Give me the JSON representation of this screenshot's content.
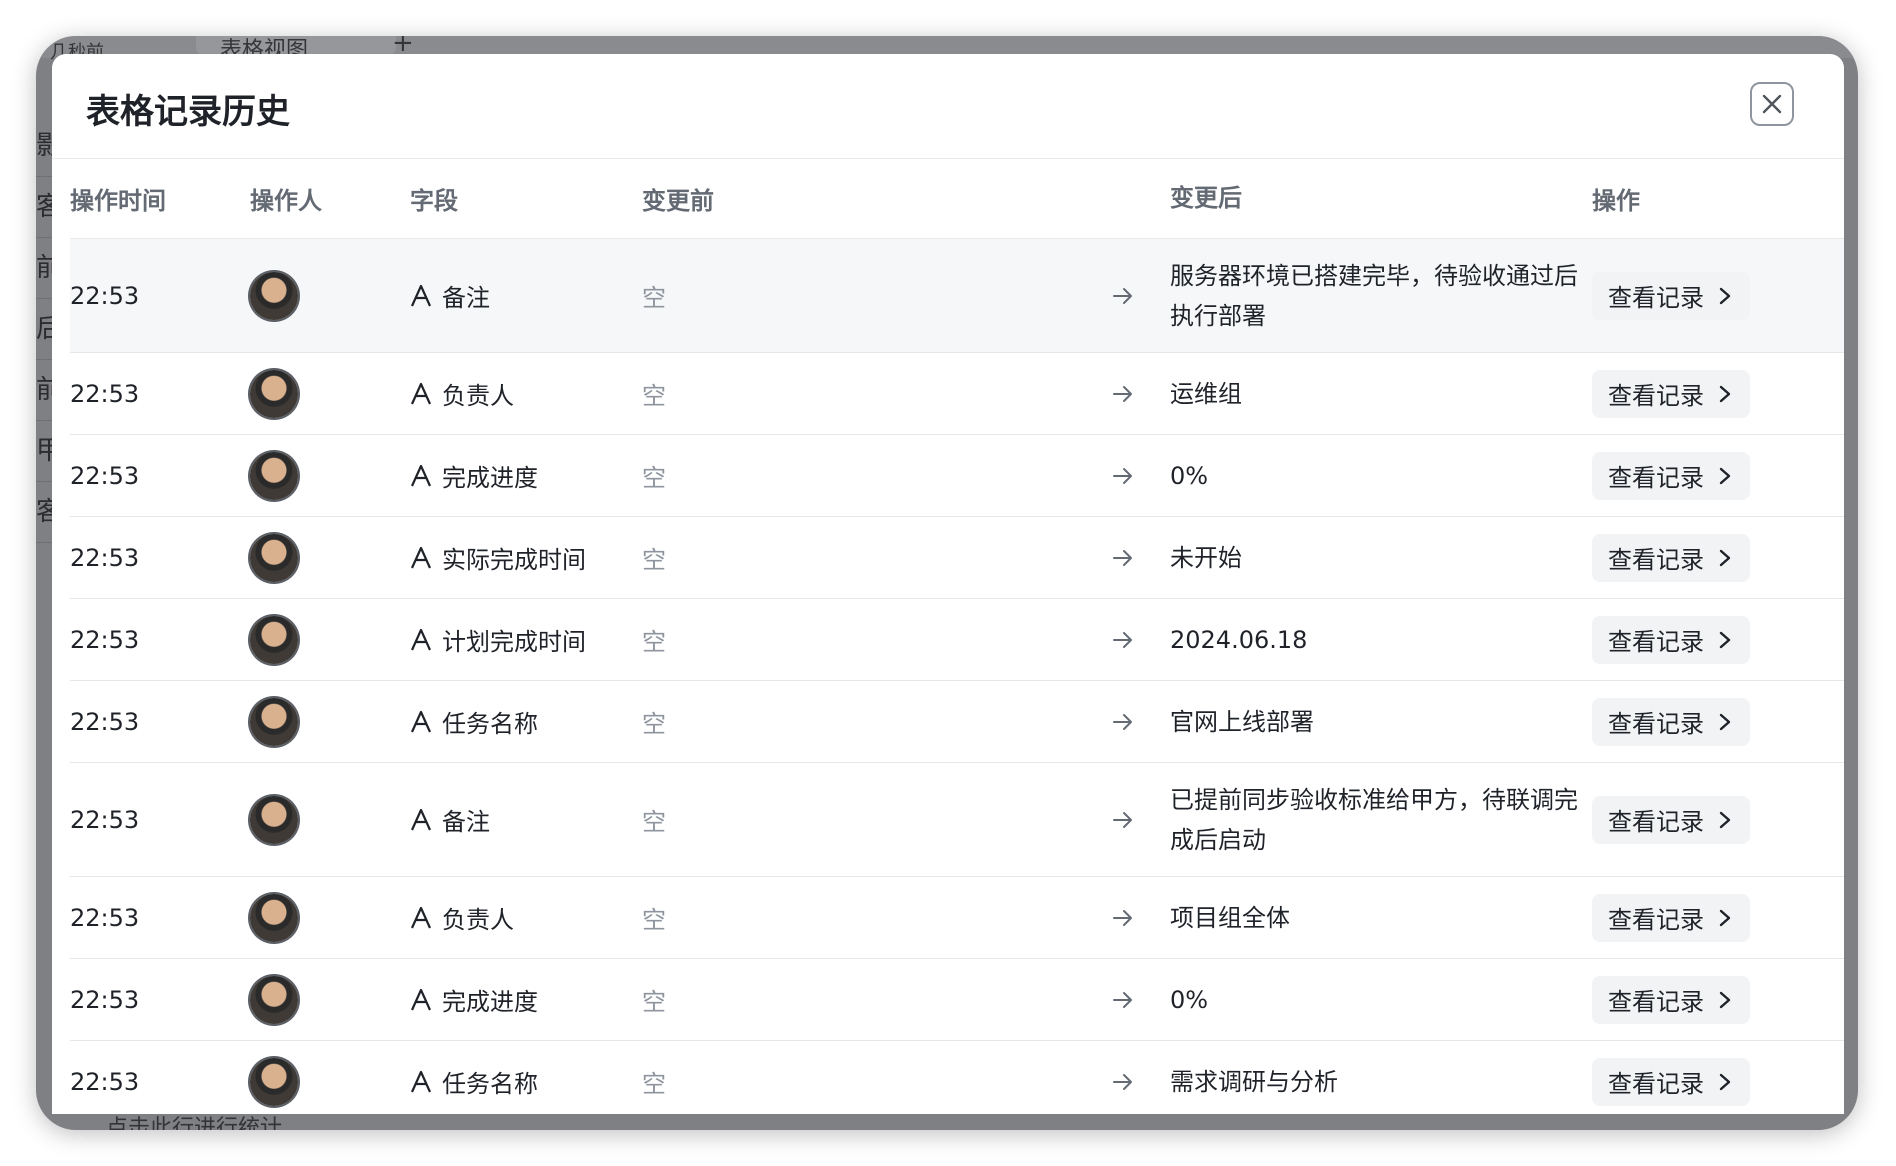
{
  "background": {
    "top_text": "几秒前",
    "tab_label": "表格视图",
    "add_label": "+",
    "bottom_text": "点击此行进行统计",
    "left_fragments": [
      "影",
      "客",
      "前",
      "后",
      "前",
      "甲",
      "客"
    ]
  },
  "dialog": {
    "title": "表格记录历史",
    "close_icon": "close-icon"
  },
  "table": {
    "headers": {
      "time": "操作时间",
      "user": "操作人",
      "field": "字段",
      "before": "变更前",
      "after": "变更后",
      "op": "操作"
    },
    "rows": [
      {
        "time": "22:53",
        "field": "备注",
        "before": "空",
        "after": "服务器环境已搭建完毕，待验收通过后执行部署",
        "op": "查看记录"
      },
      {
        "time": "22:53",
        "field": "负责人",
        "before": "空",
        "after": "运维组",
        "op": "查看记录"
      },
      {
        "time": "22:53",
        "field": "完成进度",
        "before": "空",
        "after": "0%",
        "op": "查看记录"
      },
      {
        "time": "22:53",
        "field": "实际完成时间",
        "before": "空",
        "after": "未开始",
        "op": "查看记录"
      },
      {
        "time": "22:53",
        "field": "计划完成时间",
        "before": "空",
        "after": "2024.06.18",
        "op": "查看记录"
      },
      {
        "time": "22:53",
        "field": "任务名称",
        "before": "空",
        "after": "官网上线部署",
        "op": "查看记录"
      },
      {
        "time": "22:53",
        "field": "备注",
        "before": "空",
        "after": "已提前同步验收标准给甲方，待联调完成后启动",
        "op": "查看记录"
      },
      {
        "time": "22:53",
        "field": "负责人",
        "before": "空",
        "after": "项目组全体",
        "op": "查看记录"
      },
      {
        "time": "22:53",
        "field": "完成进度",
        "before": "空",
        "after": "0%",
        "op": "查看记录"
      },
      {
        "time": "22:53",
        "field": "任务名称",
        "before": "空",
        "after": "需求调研与分析",
        "op": "查看记录"
      }
    ]
  }
}
